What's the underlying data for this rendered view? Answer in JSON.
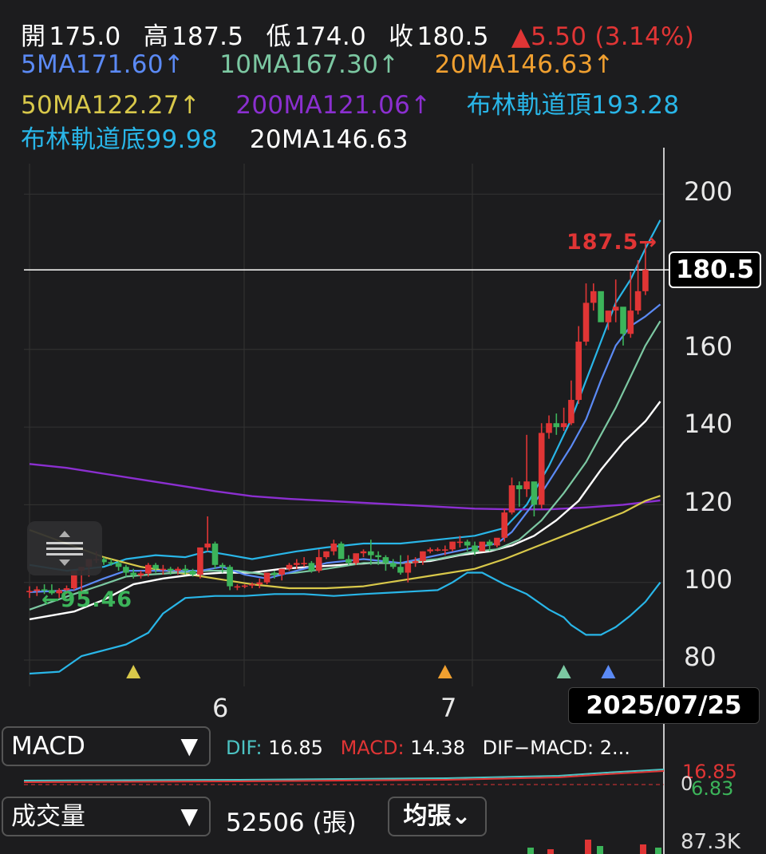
{
  "header": {
    "open_label": "開",
    "open": "175.0",
    "high_label": "高",
    "high": "187.5",
    "low_label": "低",
    "low": "174.0",
    "close_label": "收",
    "close": "180.5",
    "change": "▲5.50 (3.14%)",
    "ma5": "5MA171.60↑",
    "ma10": "10MA167.30↑",
    "ma20": "20MA146.63↑",
    "ma50": "50MA122.27↑",
    "ma200": "200MA121.06↑",
    "boll_top": "布林軌道頂193.28",
    "boll_bottom": "布林軌道底99.98",
    "boll_mid": "20MA146.63"
  },
  "colors": {
    "up": "#e03535",
    "down": "#3cb45a",
    "ma5": "#5b8af5",
    "ma10": "#7cc8a2",
    "ma20": "#ffffff",
    "ma20_label": "#f0a030",
    "ma50": "#d8c84a",
    "ma200": "#8b2fd0",
    "boll": "#29b6e8",
    "background": "#1c1c1e"
  },
  "chart_data": {
    "type": "candlestick",
    "y_ticks": [
      "200",
      "160",
      "140",
      "120",
      "100",
      "80"
    ],
    "x_ticks": [
      "6",
      "7"
    ],
    "ylim": [
      80,
      200
    ],
    "current_price": "180.5",
    "selected_date": "2025/07/25",
    "high_marker": "187.5→",
    "low_marker": "←95.46",
    "candles": [
      [
        97.5,
        99,
        96,
        97.8
      ],
      [
        97.8,
        99,
        96.5,
        98.2
      ],
      [
        98.2,
        99.5,
        97,
        98
      ],
      [
        98,
        99.5,
        96.8,
        97.2
      ],
      [
        97.2,
        98.5,
        96,
        98
      ],
      [
        98,
        99.2,
        97,
        98.5
      ],
      [
        98.5,
        101,
        98,
        103
      ],
      [
        103,
        104,
        96,
        104
      ],
      [
        104,
        105.5,
        101.5,
        106
      ],
      [
        106,
        108,
        105,
        106
      ],
      [
        106,
        106.5,
        104.5,
        105.2
      ],
      [
        105.2,
        106,
        104.3,
        105
      ],
      [
        105,
        105.5,
        103,
        104
      ],
      [
        104,
        104.5,
        101.5,
        102.5
      ],
      [
        102.5,
        103.5,
        101,
        101.8
      ],
      [
        101.8,
        103,
        101,
        102.3
      ],
      [
        102.3,
        105,
        101.5,
        104.5
      ],
      [
        104.5,
        105,
        102.5,
        103.5
      ],
      [
        103.5,
        104.5,
        102,
        103.5
      ],
      [
        103.5,
        104,
        102,
        103
      ],
      [
        103,
        104,
        102,
        103.5
      ],
      [
        103.5,
        104.5,
        102,
        103
      ],
      [
        103,
        103.5,
        101.5,
        102
      ],
      [
        102,
        104,
        101,
        109
      ],
      [
        109,
        117,
        108,
        110
      ],
      [
        110,
        110.5,
        103.5,
        104.5
      ],
      [
        104.5,
        105,
        102.5,
        104
      ],
      [
        104,
        104.5,
        98,
        99
      ],
      [
        99,
        99.5,
        98,
        99
      ],
      [
        99,
        99.5,
        98.5,
        99.2
      ],
      [
        99.2,
        100,
        98.5,
        99.5
      ],
      [
        99.5,
        101,
        98.5,
        100
      ],
      [
        100,
        102.5,
        99.5,
        102.5
      ],
      [
        102.5,
        103,
        101,
        102
      ],
      [
        102,
        103.5,
        100.5,
        103.5
      ],
      [
        103.5,
        105,
        103,
        104.5
      ],
      [
        104.5,
        106,
        103.5,
        105
      ],
      [
        105,
        106.5,
        104,
        105
      ],
      [
        105,
        105.5,
        102.5,
        103
      ],
      [
        103,
        108.5,
        102.5,
        106.5
      ],
      [
        106.5,
        108,
        106,
        108
      ],
      [
        108,
        111,
        107,
        110
      ],
      [
        110,
        110.5,
        106,
        106
      ],
      [
        106,
        107,
        104.5,
        105
      ],
      [
        105,
        107,
        104.5,
        107.5
      ],
      [
        107.5,
        108.5,
        106.5,
        108
      ],
      [
        108,
        111,
        104.5,
        107
      ],
      [
        107,
        108,
        104.5,
        106.5
      ],
      [
        106.5,
        107,
        103,
        105
      ],
      [
        105,
        106,
        103.5,
        104
      ],
      [
        104,
        107,
        102,
        102.5
      ],
      [
        102.5,
        107,
        100,
        105
      ],
      [
        105,
        106.5,
        104,
        105.5
      ],
      [
        105.5,
        108,
        104.5,
        108
      ],
      [
        108,
        109,
        107.5,
        108.5
      ],
      [
        108.5,
        109,
        108,
        108.5
      ],
      [
        108.5,
        109.5,
        107,
        108.5
      ],
      [
        108.5,
        110.5,
        108,
        110.5
      ],
      [
        110.5,
        112,
        109,
        110.5
      ],
      [
        110.5,
        111,
        108,
        109.5
      ],
      [
        109.5,
        110.5,
        107,
        108
      ],
      [
        108,
        110,
        108,
        110.5
      ],
      [
        110.5,
        111,
        108,
        109.5
      ],
      [
        109.5,
        111,
        109,
        111.5
      ],
      [
        111.5,
        119,
        110.5,
        118
      ],
      [
        118,
        127,
        117.5,
        125
      ],
      [
        125,
        126,
        119.5,
        124
      ],
      [
        124,
        138,
        122,
        126
      ],
      [
        126,
        125,
        117,
        120
      ],
      [
        120,
        141,
        119,
        138.5
      ],
      [
        138.5,
        143,
        137,
        141
      ],
      [
        141,
        143.5,
        138,
        140
      ],
      [
        140,
        145,
        139,
        141
      ],
      [
        141,
        152,
        140.5,
        147
      ],
      [
        147,
        166,
        146,
        162
      ],
      [
        162,
        177,
        161,
        172
      ],
      [
        172,
        177,
        170,
        175
      ],
      [
        175,
        172,
        170,
        167
      ],
      [
        167,
        168,
        165,
        170
      ],
      [
        170,
        178,
        167,
        171
      ],
      [
        171,
        169,
        161,
        164
      ],
      [
        164,
        180,
        163,
        170
      ],
      [
        170,
        183,
        169,
        175
      ],
      [
        175,
        187.5,
        174,
        180.5
      ]
    ],
    "ma5": [
      [
        0,
        97.5
      ],
      [
        6,
        98
      ],
      [
        10,
        101
      ],
      [
        13,
        103
      ],
      [
        16,
        103
      ],
      [
        20,
        103
      ],
      [
        23,
        103
      ],
      [
        26,
        104
      ],
      [
        29,
        102
      ],
      [
        32,
        101
      ],
      [
        36,
        103
      ],
      [
        40,
        105
      ],
      [
        45,
        106
      ],
      [
        50,
        105
      ],
      [
        55,
        107
      ],
      [
        60,
        109
      ],
      [
        63,
        110
      ],
      [
        65,
        113
      ],
      [
        67,
        118
      ],
      [
        69,
        123
      ],
      [
        71,
        129
      ],
      [
        73,
        135
      ],
      [
        75,
        142
      ],
      [
        77,
        152
      ],
      [
        79,
        161
      ],
      [
        81,
        166
      ],
      [
        83,
        168.5
      ],
      [
        85,
        171.6
      ]
    ],
    "ma10": [
      [
        0,
        93
      ],
      [
        6,
        97
      ],
      [
        10,
        99.5
      ],
      [
        13,
        101.5
      ],
      [
        16,
        102
      ],
      [
        20,
        102.5
      ],
      [
        24,
        103
      ],
      [
        28,
        103
      ],
      [
        32,
        102
      ],
      [
        36,
        102.5
      ],
      [
        40,
        103.5
      ],
      [
        45,
        105
      ],
      [
        50,
        105
      ],
      [
        55,
        106
      ],
      [
        60,
        108
      ],
      [
        63,
        108.5
      ],
      [
        66,
        111
      ],
      [
        69,
        116
      ],
      [
        72,
        123
      ],
      [
        75,
        131
      ],
      [
        77,
        138
      ],
      [
        79,
        145
      ],
      [
        81,
        153
      ],
      [
        83,
        161
      ],
      [
        85,
        167.3
      ]
    ],
    "ma20": [
      [
        0,
        90.5
      ],
      [
        6,
        92.5
      ],
      [
        10,
        95.5
      ],
      [
        14,
        99.5
      ],
      [
        18,
        101
      ],
      [
        22,
        102
      ],
      [
        26,
        102.5
      ],
      [
        30,
        102.5
      ],
      [
        34,
        103.5
      ],
      [
        38,
        104
      ],
      [
        42,
        104.5
      ],
      [
        46,
        105
      ],
      [
        50,
        105
      ],
      [
        54,
        105.5
      ],
      [
        58,
        107
      ],
      [
        62,
        108
      ],
      [
        65,
        109.5
      ],
      [
        68,
        112
      ],
      [
        71,
        116
      ],
      [
        74,
        121
      ],
      [
        77,
        129
      ],
      [
        80,
        136
      ],
      [
        83,
        141.5
      ],
      [
        85,
        146.6
      ]
    ],
    "ma50": [
      [
        0,
        113.5
      ],
      [
        5,
        110
      ],
      [
        10,
        106.5
      ],
      [
        15,
        104
      ],
      [
        20,
        102.5
      ],
      [
        25,
        101
      ],
      [
        30,
        99.5
      ],
      [
        35,
        98.5
      ],
      [
        40,
        98.5
      ],
      [
        45,
        99
      ],
      [
        50,
        100.5
      ],
      [
        55,
        102
      ],
      [
        60,
        103.5
      ],
      [
        64,
        106
      ],
      [
        68,
        109
      ],
      [
        72,
        112
      ],
      [
        76,
        115
      ],
      [
        80,
        118
      ],
      [
        83,
        121
      ],
      [
        85,
        122.3
      ]
    ],
    "ma200": [
      [
        0,
        130.5
      ],
      [
        5,
        129.5
      ],
      [
        10,
        128
      ],
      [
        15,
        126.5
      ],
      [
        20,
        125
      ],
      [
        25,
        123.5
      ],
      [
        30,
        122.2
      ],
      [
        35,
        121.5
      ],
      [
        40,
        121
      ],
      [
        45,
        120.5
      ],
      [
        50,
        120
      ],
      [
        55,
        119.5
      ],
      [
        60,
        119
      ],
      [
        65,
        118.8
      ],
      [
        70,
        118.8
      ],
      [
        75,
        119.3
      ],
      [
        80,
        120
      ],
      [
        85,
        121.1
      ]
    ],
    "boll_top": [
      [
        0,
        104.5
      ],
      [
        5,
        103
      ],
      [
        10,
        104
      ],
      [
        13,
        106
      ],
      [
        17,
        107
      ],
      [
        21,
        106.5
      ],
      [
        24,
        108
      ],
      [
        27,
        107
      ],
      [
        30,
        106
      ],
      [
        33,
        107
      ],
      [
        36,
        108
      ],
      [
        40,
        109
      ],
      [
        45,
        110
      ],
      [
        50,
        110
      ],
      [
        55,
        111
      ],
      [
        60,
        112
      ],
      [
        64,
        114
      ],
      [
        67,
        120
      ],
      [
        70,
        130
      ],
      [
        73,
        142
      ],
      [
        75,
        152
      ],
      [
        77,
        162
      ],
      [
        79,
        172
      ],
      [
        81,
        178
      ],
      [
        83,
        186
      ],
      [
        85,
        193.3
      ]
    ],
    "boll_bottom": [
      [
        0,
        76.5
      ],
      [
        4,
        77
      ],
      [
        7,
        81
      ],
      [
        10,
        82.5
      ],
      [
        13,
        84
      ],
      [
        16,
        87
      ],
      [
        18,
        92
      ],
      [
        21,
        96
      ],
      [
        25,
        96.5
      ],
      [
        29,
        96.5
      ],
      [
        33,
        97
      ],
      [
        37,
        97
      ],
      [
        41,
        96.5
      ],
      [
        45,
        97
      ],
      [
        50,
        97.5
      ],
      [
        55,
        98
      ],
      [
        57,
        100
      ],
      [
        59,
        102.5
      ],
      [
        61,
        102.5
      ],
      [
        64,
        99.5
      ],
      [
        67,
        97
      ],
      [
        70,
        93
      ],
      [
        72,
        91
      ],
      [
        73,
        89
      ],
      [
        75,
        86.5
      ],
      [
        77,
        86.5
      ],
      [
        79,
        88.5
      ],
      [
        81,
        91.5
      ],
      [
        83,
        95
      ],
      [
        85,
        100
      ]
    ],
    "signal_markers": [
      {
        "idx": 14,
        "color": "#d8c84a"
      },
      {
        "idx": 56,
        "color": "#f0a030"
      },
      {
        "idx": 72,
        "color": "#7cc8a2"
      },
      {
        "idx": 78,
        "color": "#5b8af5"
      }
    ]
  },
  "macd_panel": {
    "selector": "MACD",
    "caret": "▼",
    "dif_label": "DIF:",
    "dif": "16.85",
    "macd_label": "MACD:",
    "macd": "14.38",
    "diff_label": "DIF−MACD:",
    "diff": "2...",
    "axis_top": "16.85",
    "axis_zero": "0",
    "axis_low": "6.83"
  },
  "volume_panel": {
    "selector": "成交量",
    "caret": "▼",
    "value": "52506 (張)",
    "mode": "均張⌄",
    "axis_top": "87.3K"
  }
}
